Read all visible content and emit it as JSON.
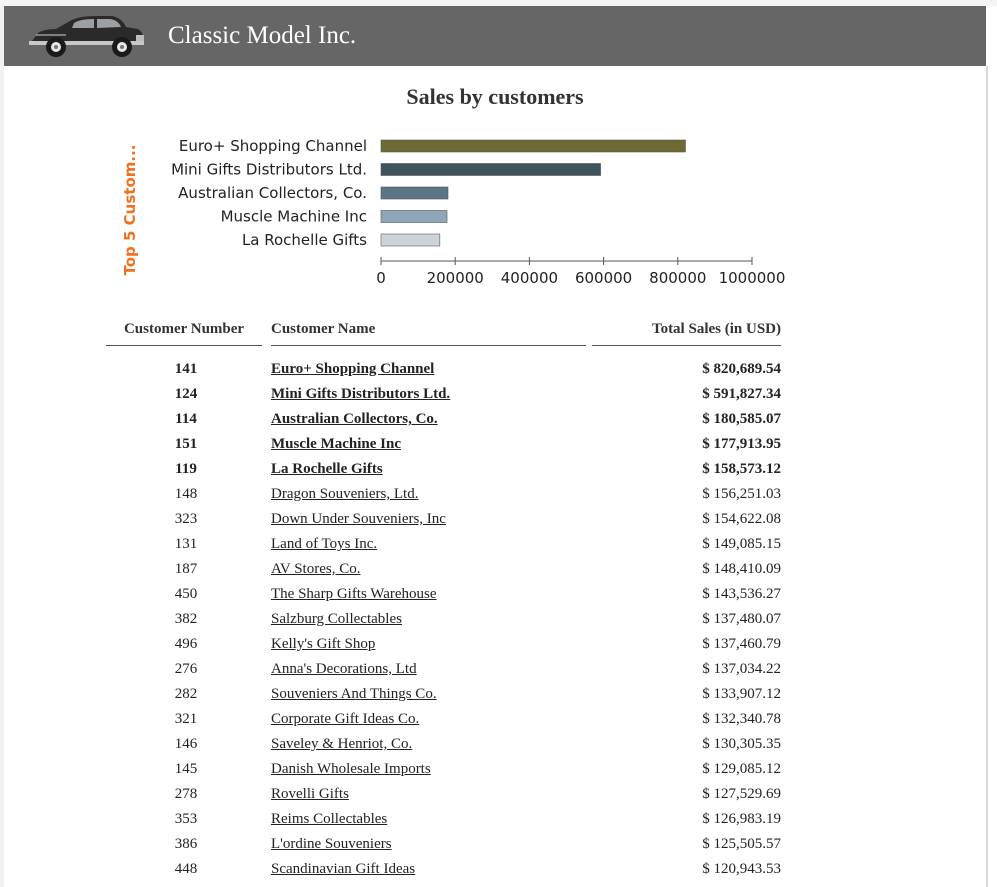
{
  "header": {
    "brand": "Classic Model Inc."
  },
  "report": {
    "title": "Sales by customers"
  },
  "chart_data": {
    "type": "bar",
    "orientation": "horizontal",
    "categories": [
      "Euro+ Shopping Channel",
      "Mini Gifts Distributors Ltd.",
      "Australian Collectors, Co.",
      "Muscle Machine Inc",
      "La Rochelle Gifts"
    ],
    "values": [
      820689.54,
      591827.34,
      180585.07,
      177913.95,
      158573.12
    ],
    "colors": [
      "#6e6a33",
      "#3d545b",
      "#5c7584",
      "#8ea6b8",
      "#ccd3d9"
    ],
    "ylabel": "Top 5 Custom...",
    "ylabel_color": "#f07020",
    "xlim": [
      0,
      1000000
    ],
    "xticks": [
      "0",
      "200000",
      "400000",
      "600000",
      "800000",
      "1000000"
    ],
    "grid": false
  },
  "table": {
    "headers": {
      "number": "Customer Number",
      "name": "Customer Name",
      "total": "Total Sales (in USD)"
    },
    "rows": [
      {
        "number": "141",
        "name": "Euro+ Shopping Channel",
        "total": "$ 820,689.54",
        "top": true
      },
      {
        "number": "124",
        "name": "Mini Gifts Distributors Ltd.",
        "total": "$ 591,827.34",
        "top": true
      },
      {
        "number": "114",
        "name": "Australian Collectors, Co.",
        "total": "$ 180,585.07",
        "top": true
      },
      {
        "number": "151",
        "name": "Muscle Machine Inc",
        "total": "$ 177,913.95",
        "top": true
      },
      {
        "number": "119",
        "name": "La Rochelle Gifts",
        "total": "$ 158,573.12",
        "top": true
      },
      {
        "number": "148",
        "name": "Dragon Souveniers, Ltd.",
        "total": "$ 156,251.03",
        "top": false
      },
      {
        "number": "323",
        "name": "Down Under Souveniers, Inc",
        "total": "$ 154,622.08",
        "top": false
      },
      {
        "number": "131",
        "name": "Land of Toys Inc.",
        "total": "$ 149,085.15",
        "top": false
      },
      {
        "number": "187",
        "name": "AV Stores, Co.",
        "total": "$ 148,410.09",
        "top": false
      },
      {
        "number": "450",
        "name": "The Sharp Gifts Warehouse",
        "total": "$ 143,536.27",
        "top": false
      },
      {
        "number": "382",
        "name": "Salzburg Collectables",
        "total": "$ 137,480.07",
        "top": false
      },
      {
        "number": "496",
        "name": "Kelly's Gift Shop",
        "total": "$ 137,460.79",
        "top": false
      },
      {
        "number": "276",
        "name": "Anna's Decorations, Ltd",
        "total": "$ 137,034.22",
        "top": false
      },
      {
        "number": "282",
        "name": "Souveniers And Things Co.",
        "total": "$ 133,907.12",
        "top": false
      },
      {
        "number": "321",
        "name": "Corporate Gift Ideas Co.",
        "total": "$ 132,340.78",
        "top": false
      },
      {
        "number": "146",
        "name": "Saveley & Henriot, Co.",
        "total": "$ 130,305.35",
        "top": false
      },
      {
        "number": "145",
        "name": "Danish Wholesale Imports",
        "total": "$ 129,085.12",
        "top": false
      },
      {
        "number": "278",
        "name": "Rovelli Gifts",
        "total": "$ 127,529.69",
        "top": false
      },
      {
        "number": "353",
        "name": "Reims Collectables",
        "total": "$ 126,983.19",
        "top": false
      },
      {
        "number": "386",
        "name": "L'ordine Souveniers",
        "total": "$ 125,505.57",
        "top": false
      },
      {
        "number": "448",
        "name": "Scandinavian Gift Ideas",
        "total": "$ 120,943.53",
        "top": false
      }
    ]
  }
}
